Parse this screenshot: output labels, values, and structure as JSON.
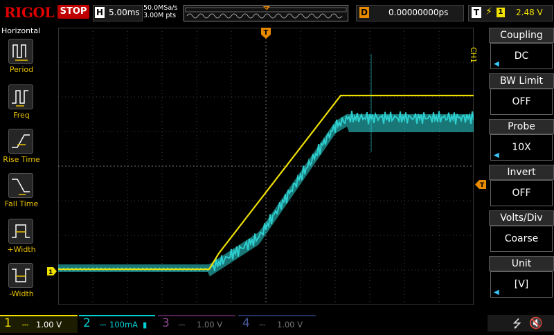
{
  "brand": {
    "logo": "RIGOL"
  },
  "run_status": "STOP",
  "horizontal": {
    "letter": "H",
    "timebase": "5.00ms"
  },
  "acquisition": {
    "sample_rate": "50.0MSa/s",
    "memory_depth": "3.00M pts"
  },
  "delay": {
    "letter": "D",
    "value": "0.00000000ps"
  },
  "trigger": {
    "letter": "T",
    "edge": "rising-edge-icon",
    "source": "1",
    "level": "2.48 V",
    "marker": "T"
  },
  "left_panel": {
    "title": "Horizontal",
    "items": [
      {
        "label": "Period",
        "icon": "period-icon"
      },
      {
        "label": "Freq",
        "icon": "freq-icon"
      },
      {
        "label": "Rise Time",
        "icon": "rise-time-icon"
      },
      {
        "label": "Fall Time",
        "icon": "fall-time-icon"
      },
      {
        "label": "+Width",
        "icon": "plus-width-icon"
      },
      {
        "label": "-Width",
        "icon": "minus-width-icon"
      }
    ]
  },
  "channel_menu": {
    "tag": "CH1",
    "items": [
      {
        "title": "Coupling",
        "value": "DC"
      },
      {
        "title": "BW Limit",
        "value": "OFF"
      },
      {
        "title": "Probe",
        "value": "10X"
      },
      {
        "title": "Invert",
        "value": "OFF"
      },
      {
        "title": "Volts/Div",
        "value": "Coarse"
      },
      {
        "title": "Unit",
        "value": "[V]"
      }
    ]
  },
  "channels": [
    {
      "num": "1",
      "scale": "1.00 V",
      "color": "#f0e000",
      "active": true
    },
    {
      "num": "2",
      "scale": "100mA",
      "color": "#00d0d0",
      "active": true
    },
    {
      "num": "3",
      "scale": "1.00 V",
      "color": "#c040c0",
      "active": false
    },
    {
      "num": "4",
      "scale": "1.00 V",
      "color": "#3070ff",
      "active": false
    }
  ],
  "ch1_marker": "1",
  "status_icons": [
    "usb-icon",
    "speaker-muted-icon"
  ],
  "colors": {
    "ch1": "#f0e000",
    "ch2": "#30d8d8",
    "trigger": "#e88a00",
    "grid": "#5a5a5a",
    "stop": "#c00000"
  }
}
